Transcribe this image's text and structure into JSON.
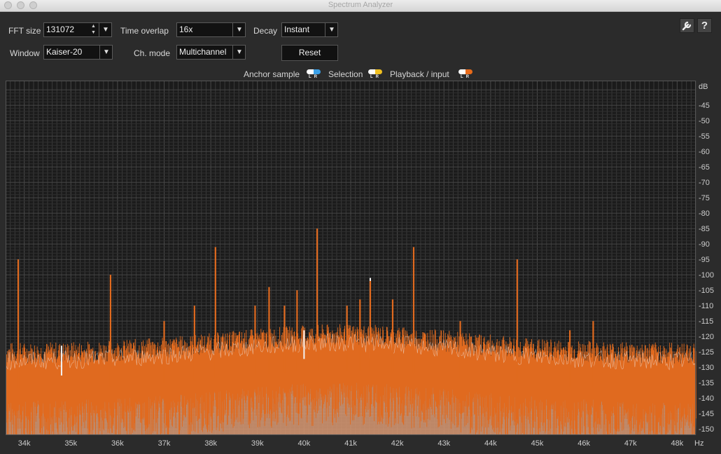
{
  "window": {
    "title": "Spectrum Analyzer"
  },
  "controls": {
    "fft_size": {
      "label": "FFT size",
      "value": "131072"
    },
    "time_overlap": {
      "label": "Time overlap",
      "value": "16x"
    },
    "decay": {
      "label": "Decay",
      "value": "Instant"
    },
    "window": {
      "label": "Window",
      "value": "Kaiser-20"
    },
    "ch_mode": {
      "label": "Ch. mode",
      "value": "Multichannel"
    },
    "reset_label": "Reset"
  },
  "icons": {
    "settings": "wrench-icon",
    "help": "help-icon"
  },
  "help_glyph": "?",
  "legend": [
    {
      "label": "Anchor sample",
      "left_color": "#ffffff",
      "right_color": "#3aa0e8"
    },
    {
      "label": "Selection",
      "left_color": "#ffffff",
      "right_color": "#f0c020"
    },
    {
      "label": "Playback / input",
      "left_color": "#ffffff",
      "right_color": "#e86a1a"
    }
  ],
  "channel_letters": "LR",
  "colors": {
    "playback": "#e06a1f",
    "playback_fill": "#d99a74",
    "selection_trace": "#f2f2f2",
    "grid": "#3a3a3a",
    "plot_bg": "#1b1b1b"
  },
  "chart_data": {
    "type": "line",
    "x_unit": "Hz",
    "y_unit": "dB",
    "xlim": [
      33600,
      48400
    ],
    "ylim": [
      -152,
      -37
    ],
    "x_tick_labels": [
      "34k",
      "35k",
      "36k",
      "37k",
      "38k",
      "39k",
      "40k",
      "41k",
      "42k",
      "43k",
      "44k",
      "45k",
      "46k",
      "47k",
      "48k"
    ],
    "x_ticks": [
      34000,
      35000,
      36000,
      37000,
      38000,
      39000,
      40000,
      41000,
      42000,
      43000,
      44000,
      45000,
      46000,
      47000,
      48000
    ],
    "y_ticks": [
      -45,
      -50,
      -55,
      -60,
      -65,
      -70,
      -75,
      -80,
      -85,
      -90,
      -95,
      -100,
      -105,
      -110,
      -115,
      -120,
      -125,
      -130,
      -135,
      -140,
      -145,
      -150
    ],
    "noise_floor_db": -133,
    "series": [
      {
        "peaks": [
          {
            "x": 33870,
            "y": -95
          },
          {
            "x": 35850,
            "y": -100
          },
          {
            "x": 37000,
            "y": -115
          },
          {
            "x": 37650,
            "y": -110
          },
          {
            "x": 38100,
            "y": -91
          },
          {
            "x": 38950,
            "y": -110
          },
          {
            "x": 39250,
            "y": -104
          },
          {
            "x": 39580,
            "y": -110
          },
          {
            "x": 39850,
            "y": -105
          },
          {
            "x": 40280,
            "y": -85
          },
          {
            "x": 40920,
            "y": -110
          },
          {
            "x": 41200,
            "y": -108
          },
          {
            "x": 41420,
            "y": -102
          },
          {
            "x": 41900,
            "y": -108
          },
          {
            "x": 42350,
            "y": -91
          },
          {
            "x": 43350,
            "y": -115
          },
          {
            "x": 44570,
            "y": -95
          },
          {
            "x": 45700,
            "y": -118
          },
          {
            "x": 46200,
            "y": -115
          }
        ]
      },
      {
        "peaks": [
          {
            "x": 34800,
            "y": -123
          },
          {
            "x": 40000,
            "y": -118
          },
          {
            "x": 41420,
            "y": -101
          }
        ]
      }
    ]
  }
}
